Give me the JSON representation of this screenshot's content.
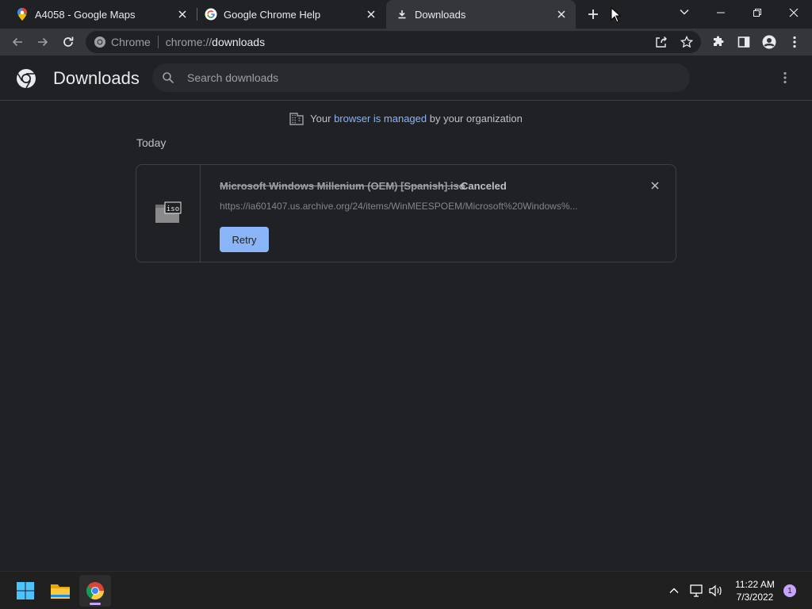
{
  "tabs": [
    {
      "title": "A4058 - Google Maps",
      "favicon": "maps-pin-icon"
    },
    {
      "title": "Google Chrome Help",
      "favicon": "google-g-icon"
    },
    {
      "title": "Downloads",
      "favicon": "download-icon",
      "active": true
    }
  ],
  "omnibox": {
    "site_chip": "Chrome",
    "url_scheme": "chrome://",
    "url_host": "downloads"
  },
  "downloads": {
    "title": "Downloads",
    "search_placeholder": "Search downloads",
    "managed_prefix": "Your ",
    "managed_link": "browser is managed",
    "managed_suffix": " by your organization",
    "section_today": "Today",
    "item": {
      "filename": "Microsoft Windows Millenium (OEM) [Spanish].iso",
      "status": "Canceled",
      "url": "https://ia601407.us.archive.org/24/items/WinMEESPOEM/Microsoft%20Windows%...",
      "retry_label": "Retry",
      "file_icon_label": "iso"
    }
  },
  "taskbar": {
    "time": "11:22 AM",
    "date": "7/3/2022",
    "notification_count": "1"
  },
  "colors": {
    "accent_blue": "#8ab4f8",
    "background": "#202124",
    "toolbar": "#35363a"
  }
}
